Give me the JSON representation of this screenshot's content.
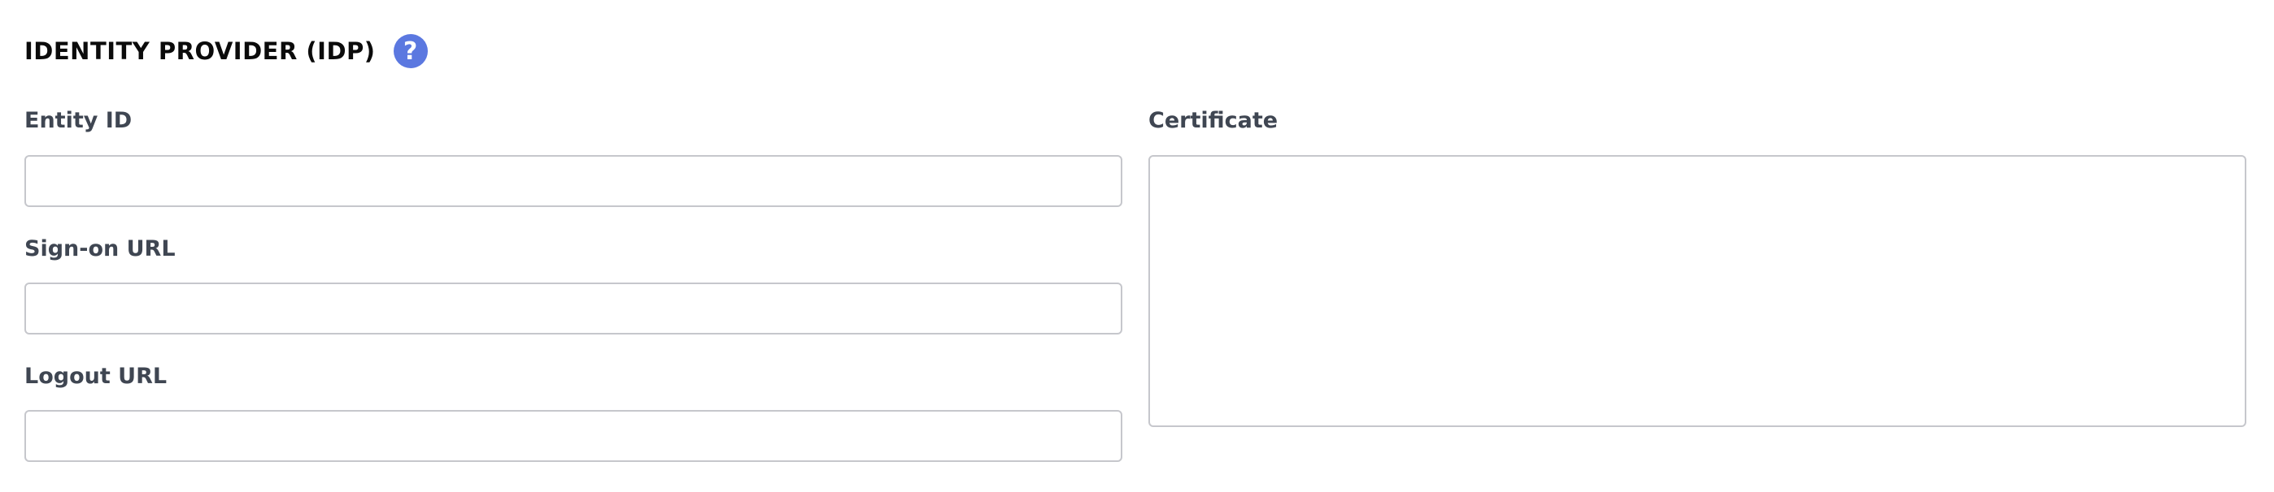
{
  "section": {
    "title": "IDENTITY PROVIDER (IDP)",
    "help_icon": "question-mark-icon",
    "help_glyph": "?",
    "accent_color": "#5b78e0"
  },
  "fields": {
    "entity_id": {
      "label": "Entity ID",
      "value": "",
      "placeholder": ""
    },
    "sign_on_url": {
      "label": "Sign-on URL",
      "value": "",
      "placeholder": ""
    },
    "logout_url": {
      "label": "Logout URL",
      "value": "",
      "placeholder": ""
    },
    "certificate": {
      "label": "Certificate",
      "value": "",
      "placeholder": ""
    }
  }
}
